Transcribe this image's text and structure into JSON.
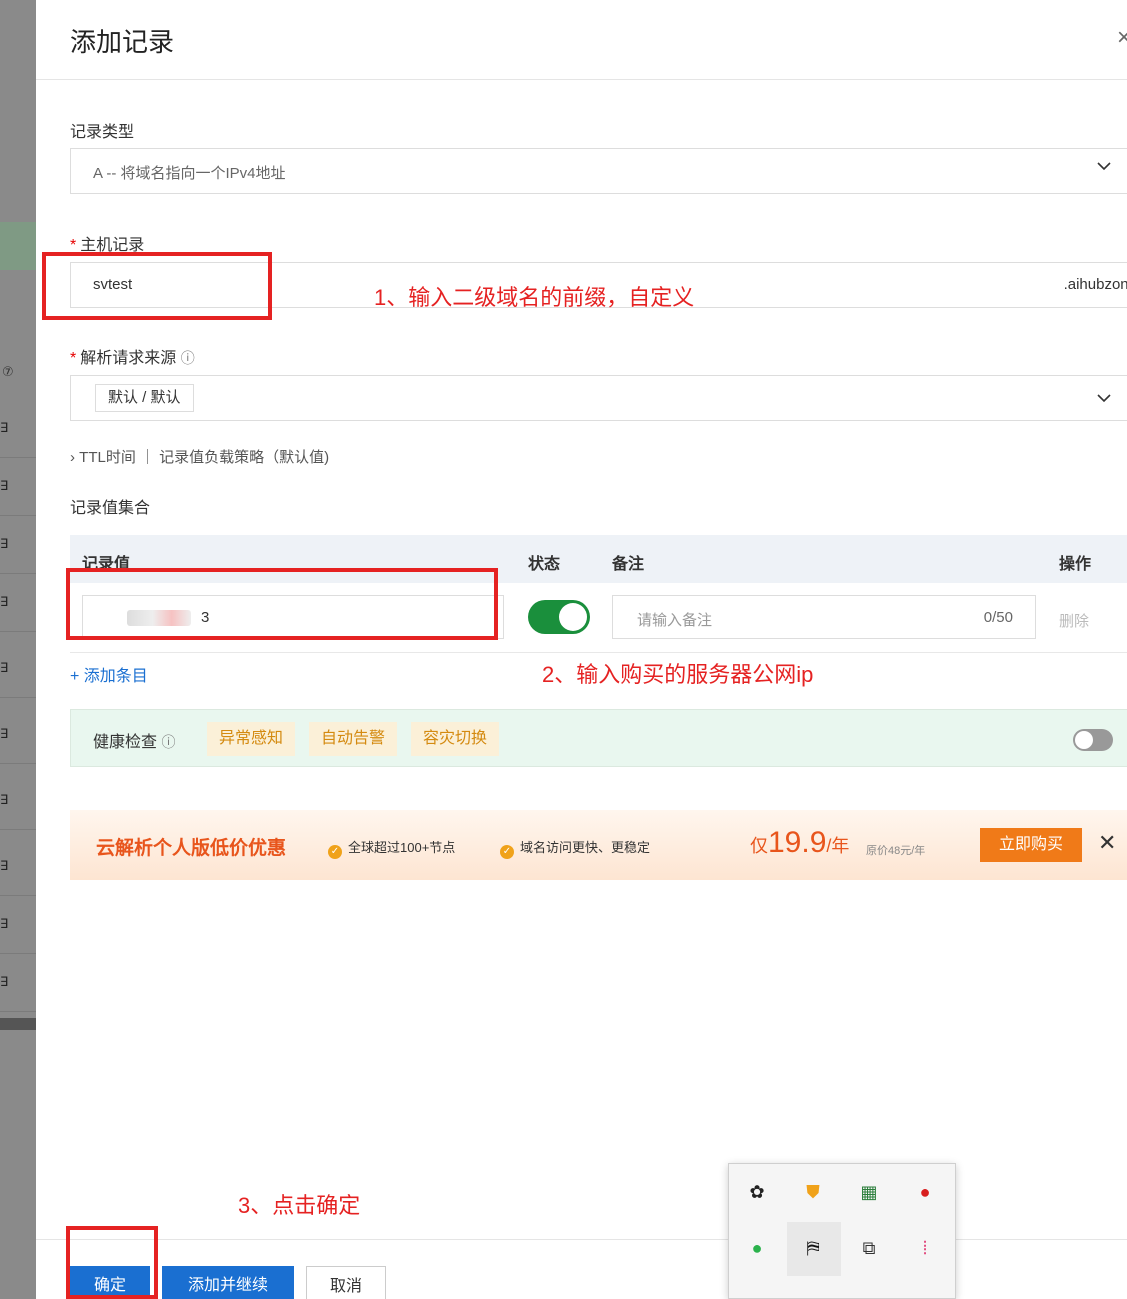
{
  "drawer": {
    "title": "添加记录",
    "close_icon": "×"
  },
  "record_type": {
    "label": "记录类型",
    "value": "A -- 将域名指向一个IPv4地址"
  },
  "host_record": {
    "label": "主机记录",
    "required_mark": "*",
    "value": "svtest",
    "suffix": ".aihubzone.cn"
  },
  "source": {
    "label": "解析请求来源",
    "required_mark": "*",
    "help_icon": "ⓘ",
    "value": "默认 / 默认"
  },
  "ttl_row": "TTL时间 ｜ 记录值负载策略（默认值)",
  "record_set": {
    "title": "记录值集合",
    "columns": [
      "记录值",
      "状态",
      "备注",
      "操作"
    ],
    "row": {
      "value_visible": "3",
      "status_on": true,
      "note_placeholder": "请输入备注",
      "note_count": "0/50",
      "action": "删除"
    },
    "add_item": "+ 添加条目"
  },
  "health": {
    "label": "健康检查",
    "tags": [
      "异常感知",
      "自动告警",
      "容灾切换"
    ],
    "enabled": false
  },
  "promo": {
    "title": "云解析个人版低价优惠",
    "features": [
      "全球超过100+节点",
      "域名访问更快、更稳定"
    ],
    "price_prefix": "仅",
    "price": "19.9",
    "price_unit": "/年",
    "original": "原价48元/年",
    "buy_label": "立即购买",
    "close": "✕"
  },
  "annotations": {
    "step1": "1、输入二级域名的前缀，自定义",
    "step2": "2、输入购买的服务器公网ip",
    "step3": "3、点击确定"
  },
  "footer": {
    "confirm": "确定",
    "add_continue": "添加并继续",
    "cancel": "取消"
  },
  "colors": {
    "primary": "#1a6fd1",
    "annotation": "#e52222",
    "toggle_on": "#1a8f3c",
    "promo_accent": "#e8551c"
  }
}
